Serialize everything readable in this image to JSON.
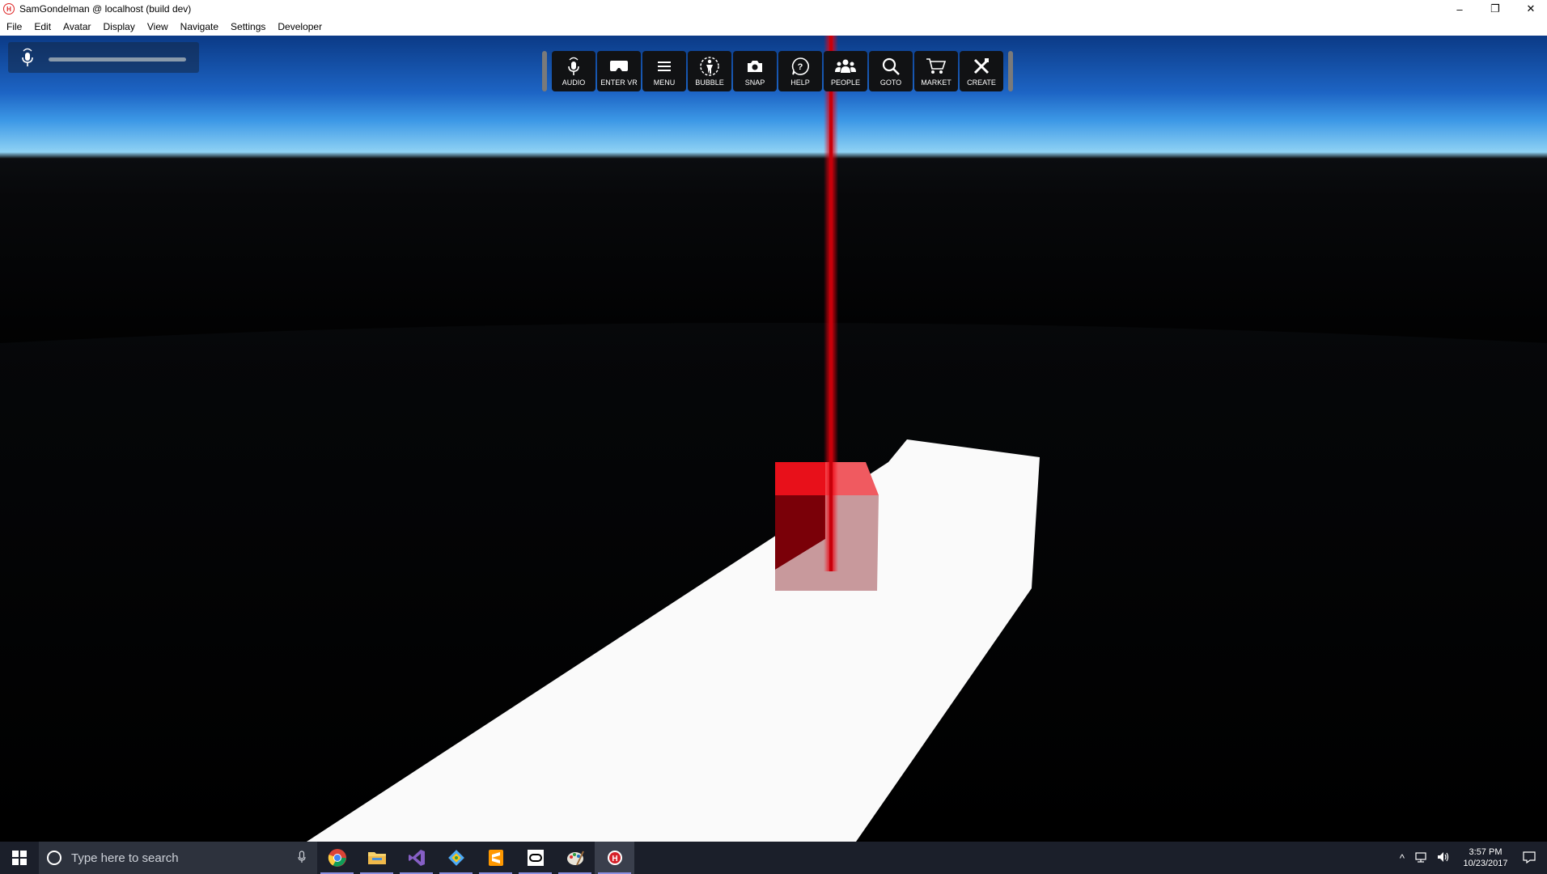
{
  "window": {
    "app_icon": "high-fidelity-logo",
    "title": "SamGondelman @ localhost (build dev)",
    "controls": {
      "minimize": "–",
      "restore": "❐",
      "close": "✕"
    }
  },
  "menu": [
    "File",
    "Edit",
    "Avatar",
    "Display",
    "View",
    "Navigate",
    "Settings",
    "Developer"
  ],
  "audio_meter": {
    "icon": "microphone-icon"
  },
  "toolbar": {
    "buttons": [
      {
        "label": "AUDIO",
        "icon": "microphone-icon"
      },
      {
        "label": "ENTER VR",
        "icon": "vr-headset-icon"
      },
      {
        "label": "MENU",
        "icon": "hamburger-menu-icon"
      },
      {
        "label": "BUBBLE",
        "icon": "bubble-person-icon"
      },
      {
        "label": "SNAP",
        "icon": "camera-icon"
      },
      {
        "label": "HELP",
        "icon": "help-icon"
      },
      {
        "label": "PEOPLE",
        "icon": "people-icon"
      },
      {
        "label": "GOTO",
        "icon": "search-icon"
      },
      {
        "label": "MARKET",
        "icon": "cart-icon"
      },
      {
        "label": "CREATE",
        "icon": "tools-icon"
      }
    ]
  },
  "scene": {
    "colors": {
      "floor": "#fafafa",
      "cube": "#e8101a",
      "laser": "#e0000a",
      "sky_horizon": "#8fd2f4"
    }
  },
  "taskbar": {
    "search_placeholder": "Type here to search",
    "apps": [
      {
        "name": "chrome-icon",
        "active": false
      },
      {
        "name": "file-explorer-icon",
        "active": false
      },
      {
        "name": "visual-studio-icon",
        "active": false
      },
      {
        "name": "git-icon",
        "active": false
      },
      {
        "name": "sublime-text-icon",
        "active": false
      },
      {
        "name": "oculus-icon",
        "active": false
      },
      {
        "name": "paint-icon",
        "active": false
      },
      {
        "name": "high-fidelity-icon",
        "active": true
      }
    ],
    "clock": {
      "time": "3:57 PM",
      "date": "10/23/2017"
    }
  }
}
